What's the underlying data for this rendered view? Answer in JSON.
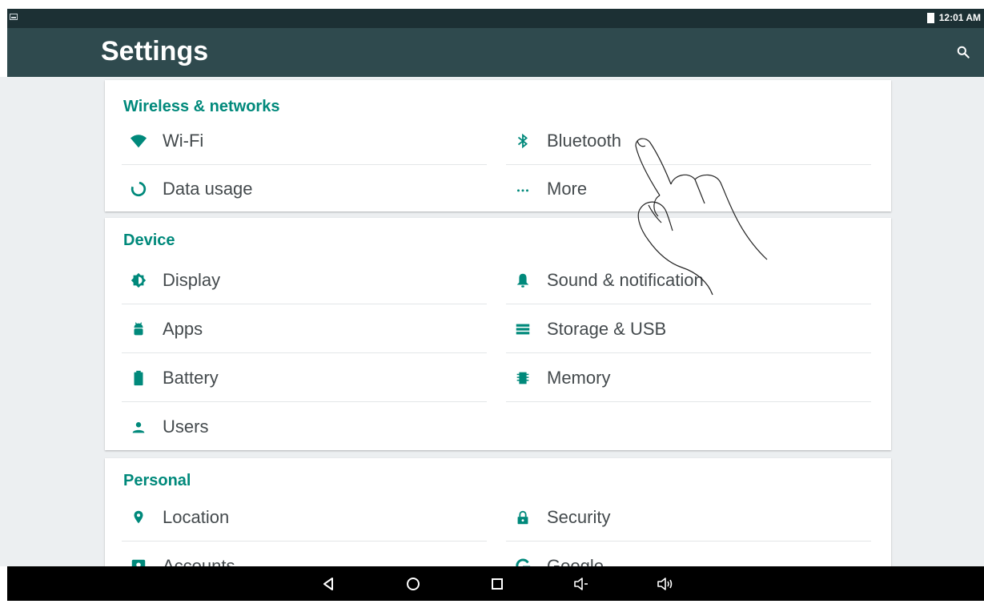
{
  "status_bar": {
    "time": "12:01 AM"
  },
  "header": {
    "title": "Settings",
    "search_icon": "search-icon"
  },
  "sections": [
    {
      "title": "Wireless & networks",
      "items": [
        {
          "label": "Wi-Fi",
          "icon": "wifi-icon"
        },
        {
          "label": "Bluetooth",
          "icon": "bluetooth-icon"
        },
        {
          "label": "Data usage",
          "icon": "data-usage-icon"
        },
        {
          "label": "More",
          "icon": "more-icon"
        }
      ]
    },
    {
      "title": "Device",
      "items": [
        {
          "label": "Display",
          "icon": "display-icon"
        },
        {
          "label": "Sound & notification",
          "icon": "bell-icon"
        },
        {
          "label": "Apps",
          "icon": "android-icon"
        },
        {
          "label": "Storage & USB",
          "icon": "storage-icon"
        },
        {
          "label": "Battery",
          "icon": "battery-icon"
        },
        {
          "label": "Memory",
          "icon": "memory-icon"
        },
        {
          "label": "Users",
          "icon": "user-icon"
        }
      ]
    },
    {
      "title": "Personal",
      "items": [
        {
          "label": "Location",
          "icon": "location-icon"
        },
        {
          "label": "Security",
          "icon": "lock-icon"
        },
        {
          "label": "Accounts",
          "icon": "accounts-icon"
        },
        {
          "label": "Google",
          "icon": "google-icon"
        }
      ]
    }
  ],
  "nav_bar": {
    "buttons": [
      "back-icon",
      "home-icon",
      "recents-icon",
      "volume-down-icon",
      "volume-up-icon"
    ]
  },
  "colors": {
    "accent": "#00897b",
    "icon": "#00897b",
    "action_bar": "#2f4a4e",
    "status_bar": "#1c3034",
    "background": "#eceff1"
  }
}
